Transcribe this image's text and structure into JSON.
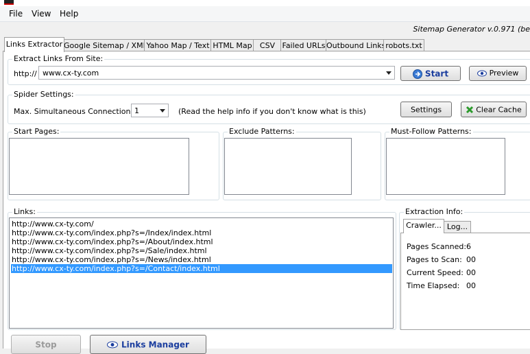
{
  "menu": [
    "File",
    "View",
    "Help"
  ],
  "version": "Sitemap Generator v.0.971 (be",
  "tabs": [
    "Links Extractor",
    "Google Sitemap / XML",
    "Yahoo Map / Text",
    "HTML Map",
    "CSV",
    "Failed URLs",
    "Outbound Links",
    "robots.txt"
  ],
  "extract": {
    "title": "Extract Links From Site:",
    "prefix": "http://",
    "url": "www.cx-ty.com",
    "start_label": "Start",
    "preview_label": "Preview"
  },
  "spider": {
    "title": "Spider Settings:",
    "connections_label": "Max. Simultaneous Connections:",
    "connections_value": "1",
    "help_text": "(Read the help info if you don't know what is this)",
    "settings_label": "Settings",
    "clear_cache_label": "Clear Cache"
  },
  "patterns": {
    "start_pages": "Start Pages:",
    "exclude": "Exclude Patterns:",
    "must_follow": "Must-Follow Patterns:"
  },
  "links": {
    "title": "Links:",
    "rows": [
      "http://www.cx-ty.com/",
      "http://www.cx-ty.com/index.php?s=/Index/index.html",
      "http://www.cx-ty.com/index.php?s=/About/index.html",
      "http://www.cx-ty.com/index.php?s=/Sale/index.html",
      "http://www.cx-ty.com/index.php?s=/News/index.html",
      "http://www.cx-ty.com/index.php?s=/Contact/index.html"
    ]
  },
  "info": {
    "title": "Extraction Info:",
    "tab_crawler": "Crawler...",
    "tab_log": "Log...",
    "pages_scanned_label": "Pages Scanned:",
    "pages_scanned_value": "6",
    "pages_to_scan_label": "Pages to Scan:",
    "pages_to_scan_value": "00",
    "speed_label": "Current Speed:",
    "speed_value": "00",
    "elapsed_label": "Time Elapsed:",
    "elapsed_value": "00"
  },
  "bottom": {
    "stop_label": "Stop",
    "links_manager_label": "Links Manager"
  },
  "colors": {
    "selection": "#3399ff",
    "accent": "#1a3d9e"
  },
  "icons": [
    "app-icon",
    "start-icon",
    "preview-eye-icon",
    "clear-cache-icon",
    "links-manager-eye-icon",
    "dropdown-arrow-icon"
  ]
}
